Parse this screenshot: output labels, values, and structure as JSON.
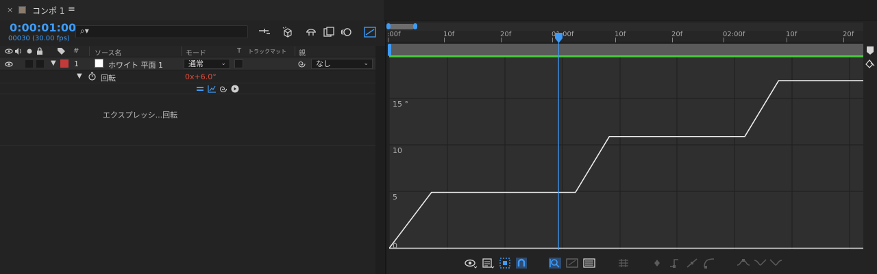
{
  "tab": {
    "close": "×",
    "title": "コンポ 1",
    "menu": "≡",
    "swatch_color": "#8a7b6c"
  },
  "timeline": {
    "timecode": "0:00:01:00",
    "frames": "00030 (30.00 fps)",
    "search_icon": "⌕▾",
    "search_value": ""
  },
  "columns": {
    "num": "#",
    "source_name": "ソース名",
    "mode": "モード",
    "t": "T",
    "track_matte": "トラックマット",
    "parent": "親"
  },
  "layer": {
    "num": "1",
    "name": "ホワイト 平面 1",
    "mode": "通常",
    "parent": "なし",
    "label_color": "#c23a3a"
  },
  "property": {
    "name": "回転",
    "value": "0x+6.0°"
  },
  "expression": {
    "label": "エクスプレッシ...回転"
  },
  "ruler": {
    "ticks": [
      ":00f",
      "10f",
      "20f",
      "01:00f",
      "10f",
      "20f",
      "02:00f",
      "10f",
      "20f"
    ]
  },
  "graph": {
    "y_labels": [
      "15 °",
      "10",
      "5",
      "0"
    ],
    "y_values": [
      15,
      10,
      5,
      0
    ],
    "curve": [
      [
        0,
        0
      ],
      [
        0.5,
        6
      ],
      [
        2.2,
        6
      ],
      [
        2.6,
        12
      ],
      [
        4.2,
        12
      ],
      [
        4.6,
        18
      ],
      [
        5.6,
        18
      ]
    ],
    "playhead_time": 2.0,
    "time_range": [
      0,
      5.6
    ],
    "value_range": [
      -0.2,
      20.5
    ],
    "accent": "#3d9bf7"
  },
  "icons": {
    "eye": "eye-icon",
    "solo": "speaker-icon",
    "lock": "lock-icon",
    "label": "tag-icon"
  }
}
